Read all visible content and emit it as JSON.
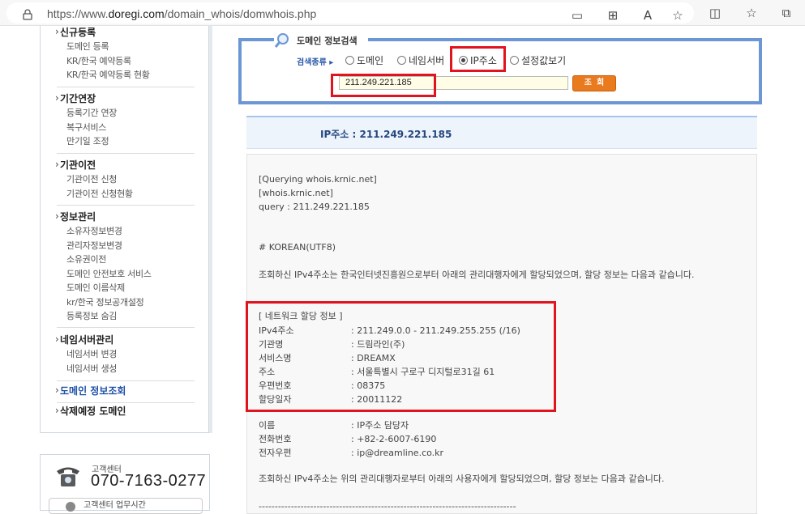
{
  "browser": {
    "url_prefix": "https://www.",
    "url_domain": "doregi.com",
    "url_path": "/domain_whois/domwhois.php"
  },
  "leftmenu": {
    "sections": [
      {
        "title": "신규등록",
        "items": [
          "도메인 등록",
          "KR/한국 예약등록",
          "KR/한국 예약등록 현황"
        ]
      },
      {
        "title": "기간연장",
        "items": [
          "등록기간 연장",
          "복구서비스",
          "만기일 조정"
        ]
      },
      {
        "title": "기관이전",
        "items": [
          "기관이전 신청",
          "기관이전 신청현황"
        ]
      },
      {
        "title": "정보관리",
        "items": [
          "소유자정보변경",
          "관리자정보변경",
          "소유권이전",
          "도메인 안전보호 서비스",
          "도메인 이름삭제",
          "kr/한국 정보공개설정",
          "등록정보 숨김"
        ]
      },
      {
        "title": "네임서버관리",
        "items": [
          "네임서버 변경",
          "네임서버 생성"
        ]
      },
      {
        "title": "도메인 정보조회",
        "items": []
      },
      {
        "title": "삭제예정 도메인",
        "items": []
      }
    ]
  },
  "customer_center": {
    "label": "고객센터",
    "number": "070-7163-0277",
    "hours": "고객센터 업무시간"
  },
  "search": {
    "title": "도메인 정보검색",
    "type_label": "검색종류 ▸",
    "options": [
      "도메인",
      "네임서버",
      "IP주소",
      "설정값보기"
    ],
    "selected": "IP주소",
    "input_value": "211.249.221.185",
    "button_label": "조회"
  },
  "result": {
    "heading": "IP주소 : 211.249.221.185",
    "line1": "[Querying whois.krnic.net]",
    "line2": "[whois.krnic.net]",
    "line3": "query : 211.249.221.185",
    "line4": "# KOREAN(UTF8)",
    "para1": "조회하신 IPv4주소는 한국인터넷진흥원으로부터 아래의 관리대행자에게 할당되었으며, 할당 정보는 다음과 같습니다.",
    "net_title": "[ 네트워크 할당 정보 ]",
    "net_info": [
      {
        "key": "IPv4주소",
        "value": ": 211.249.0.0 - 211.249.255.255 (/16)"
      },
      {
        "key": "기관명",
        "value": ": 드림라인(주)"
      },
      {
        "key": "서비스명",
        "value": ": DREAMX"
      },
      {
        "key": "주소",
        "value": ": 서울특별시 구로구 디지털로31길 61"
      },
      {
        "key": "우편번호",
        "value": ": 08375"
      },
      {
        "key": "할당일자",
        "value": ": 20011122"
      }
    ],
    "contact_info": [
      {
        "key": "이름",
        "value": ": IP주소 담당자"
      },
      {
        "key": "전화번호",
        "value": ": +82-2-6007-6190"
      },
      {
        "key": "전자우편",
        "value": ": ip@dreamline.co.kr"
      }
    ],
    "para2": "조회하신 IPv4주소는 위의 관리대행자로부터 아래의 사용자에게 할당되었으며, 할당 정보는 다음과 같습니다.",
    "divider": "--------------------------------------------------------------------------------"
  }
}
